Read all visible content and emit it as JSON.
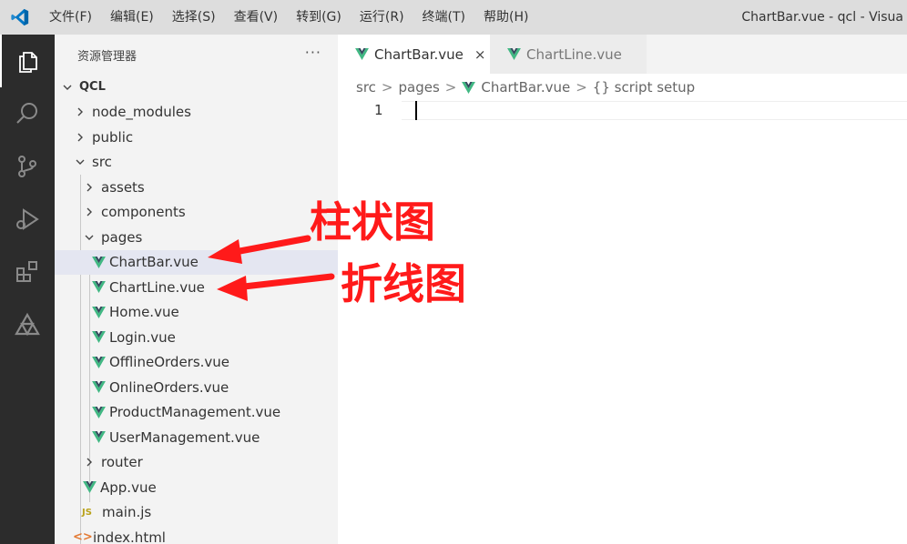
{
  "titlebar": {
    "menu": [
      "文件(F)",
      "编辑(E)",
      "选择(S)",
      "查看(V)",
      "转到(G)",
      "运行(R)",
      "终端(T)",
      "帮助(H)"
    ],
    "window_title": "ChartBar.vue - qcl - Visua"
  },
  "activitybar": {
    "items": [
      "explorer-icon",
      "search-icon",
      "source-control-icon",
      "run-debug-icon",
      "extensions-icon",
      "triangle-extension-icon"
    ]
  },
  "sidebar": {
    "header": "资源管理器",
    "more": "···",
    "root": "QCL",
    "tree": {
      "node_modules": "node_modules",
      "public": "public",
      "src": "src",
      "assets": "assets",
      "components": "components",
      "pages": "pages",
      "chartbar": "ChartBar.vue",
      "chartline": "ChartLine.vue",
      "home": "Home.vue",
      "login": "Login.vue",
      "offline": "OfflineOrders.vue",
      "online": "OnlineOrders.vue",
      "product": "ProductManagement.vue",
      "user": "UserManagement.vue",
      "router": "router",
      "app": "App.vue",
      "mainjs": "main.js",
      "index": "index.html",
      "js_badge": "JS",
      "html_badge": "<>"
    }
  },
  "tabs": {
    "active": "ChartBar.vue",
    "inactive": "ChartLine.vue",
    "close": "×"
  },
  "breadcrumb": {
    "src": "src",
    "pages": "pages",
    "file": "ChartBar.vue",
    "symbol": "{} script setup",
    "sep": ">"
  },
  "editor": {
    "line_number": "1"
  },
  "annotations": {
    "bar": "柱状图",
    "line": "折线图"
  },
  "colors": {
    "vue_green": "#41b883",
    "vue_dark": "#35495e",
    "annotation_red": "#ff1a1a",
    "vscode_blue": "#007acc"
  }
}
